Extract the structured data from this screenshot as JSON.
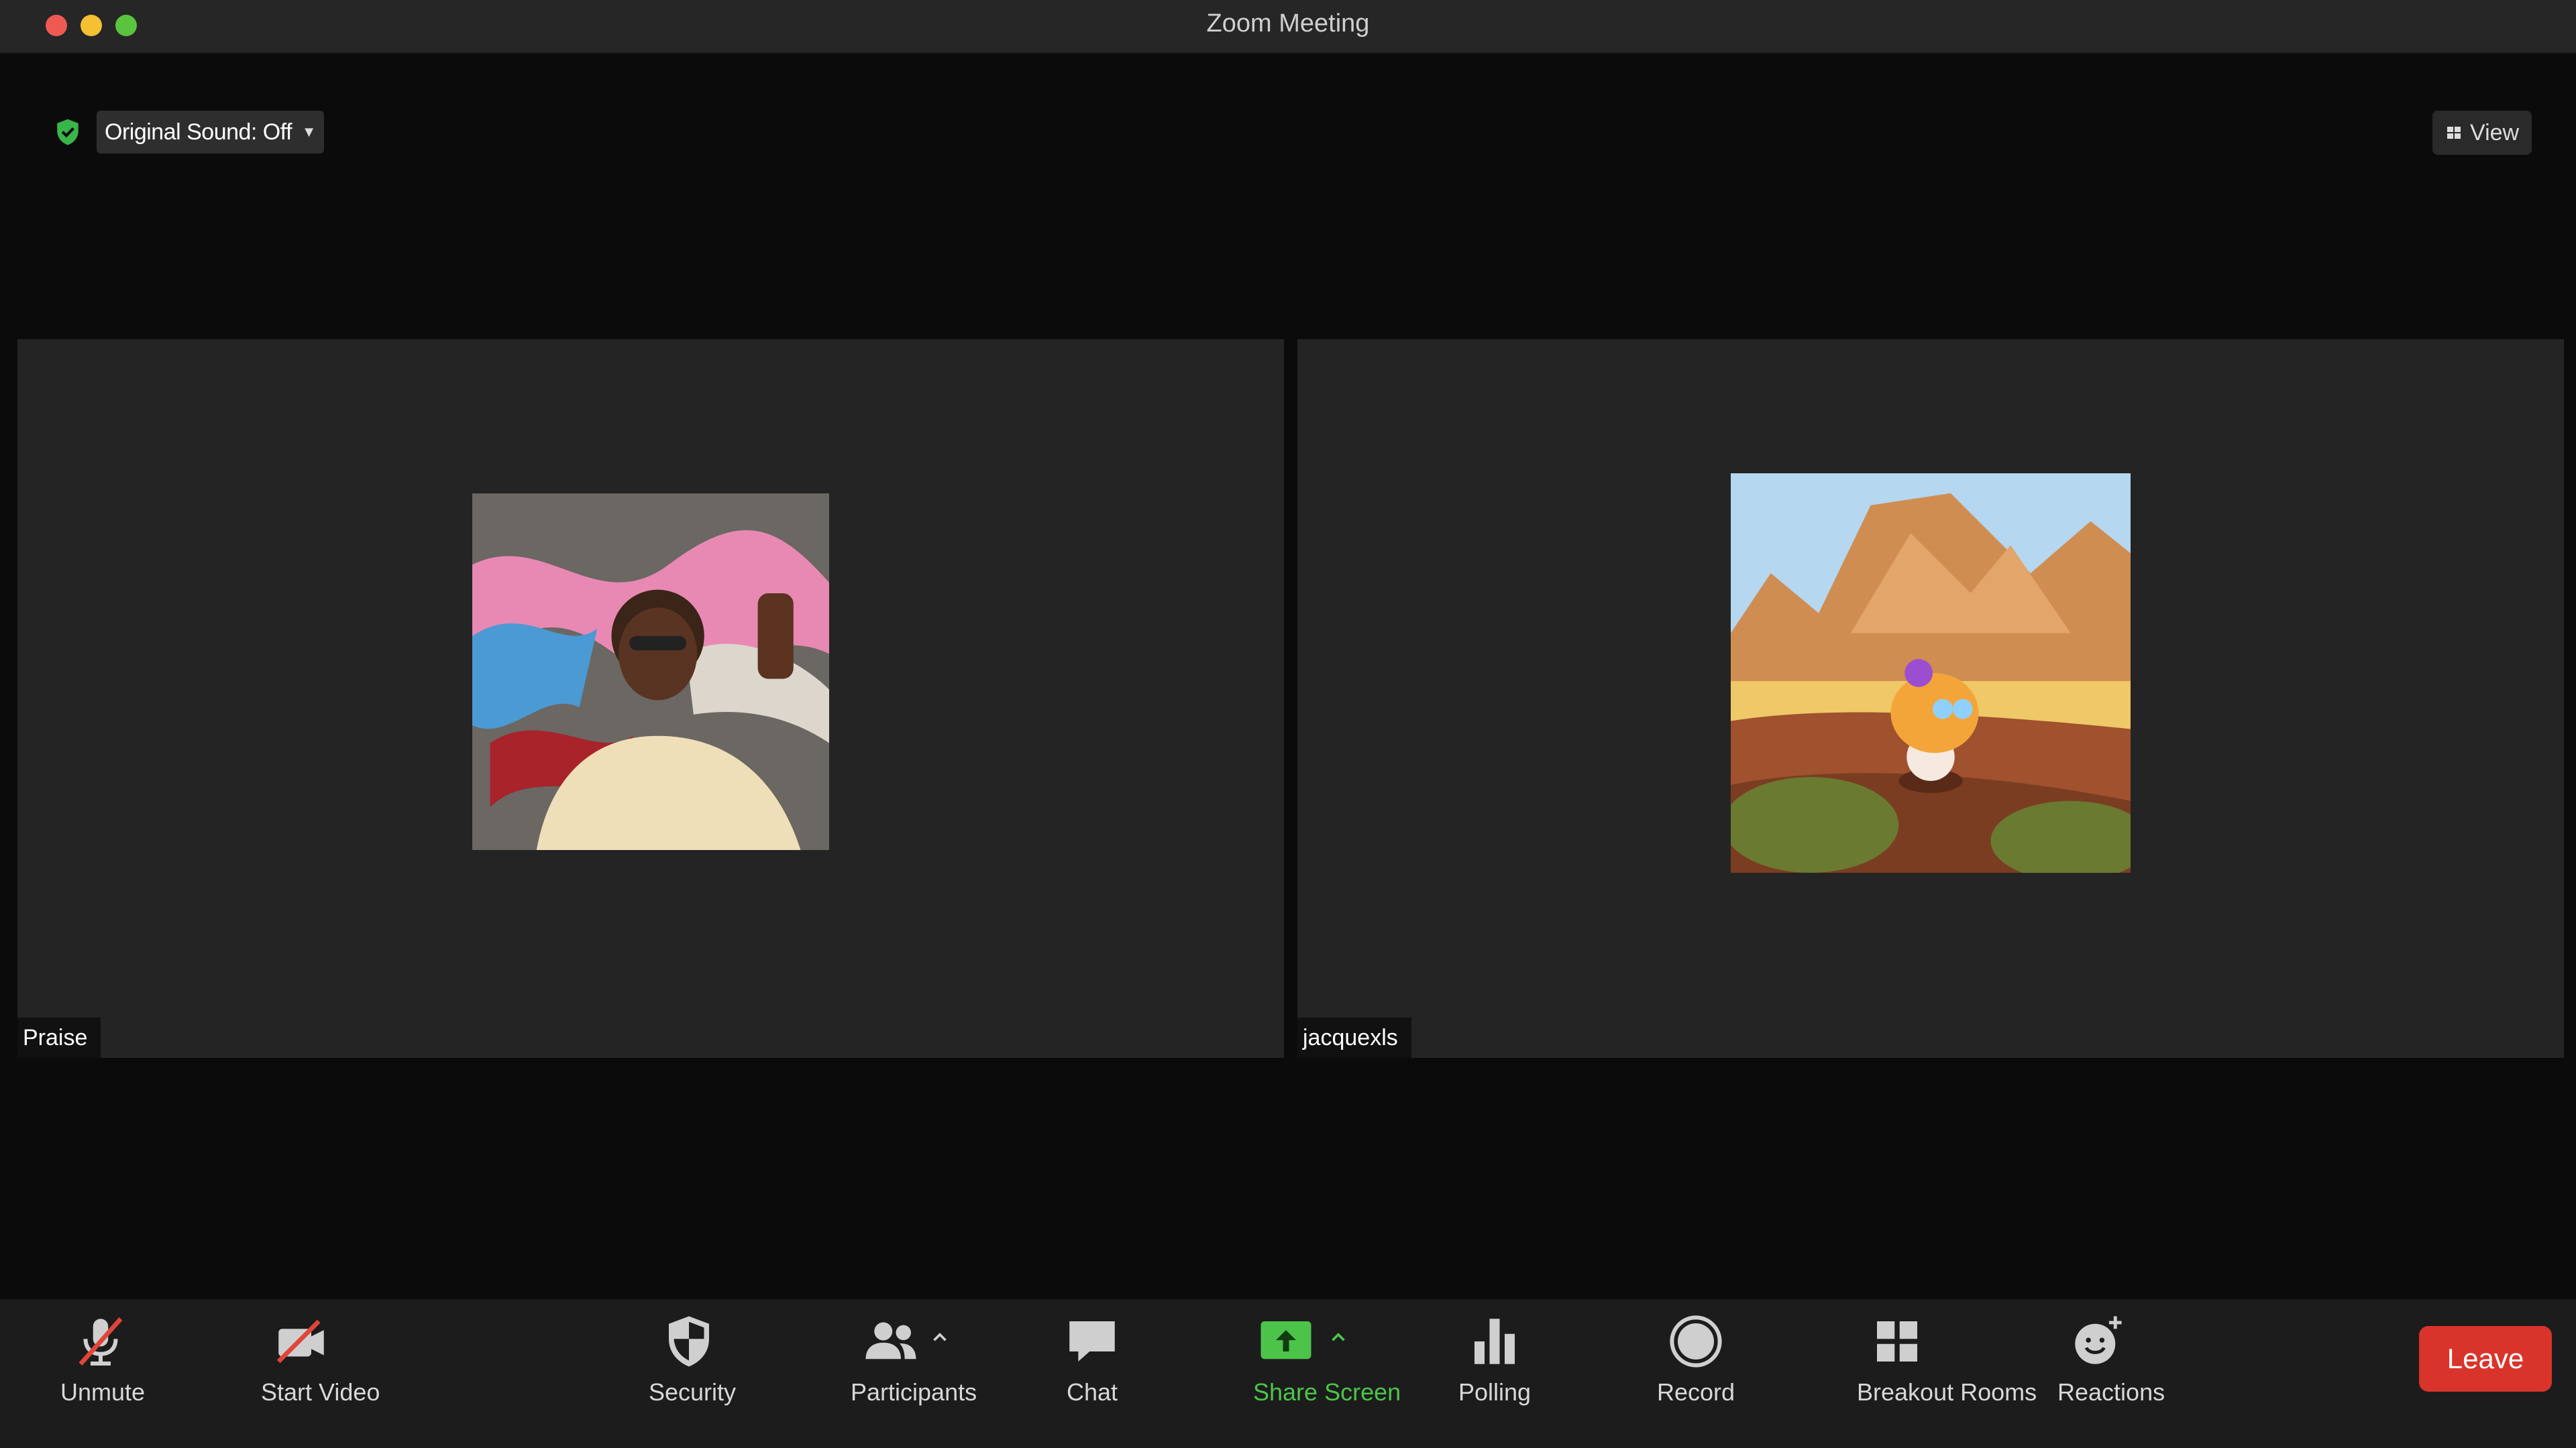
{
  "window": {
    "title": "Zoom Meeting"
  },
  "top": {
    "original_sound_label": "Original Sound: Off",
    "view_label": "View"
  },
  "participants": [
    {
      "name": "Praise"
    },
    {
      "name": "jacquexls"
    }
  ],
  "toolbar": {
    "unmute": "Unmute",
    "start_video": "Start Video",
    "security": "Security",
    "participants": "Participants",
    "chat": "Chat",
    "share_screen": "Share Screen",
    "polling": "Polling",
    "record": "Record",
    "breakout_rooms": "Breakout Rooms",
    "reactions": "Reactions",
    "leave": "Leave"
  },
  "colors": {
    "accent_green": "#4cc44a",
    "leave_red": "#d9342b"
  },
  "icons": [
    "shield-check-icon",
    "grid-icon",
    "microphone-muted-icon",
    "video-off-icon",
    "shield-icon",
    "people-icon",
    "chevron-up-icon",
    "chat-bubble-icon",
    "share-arrow-icon",
    "bar-chart-icon",
    "record-circle-icon",
    "squares-grid-icon",
    "smile-plus-icon"
  ]
}
